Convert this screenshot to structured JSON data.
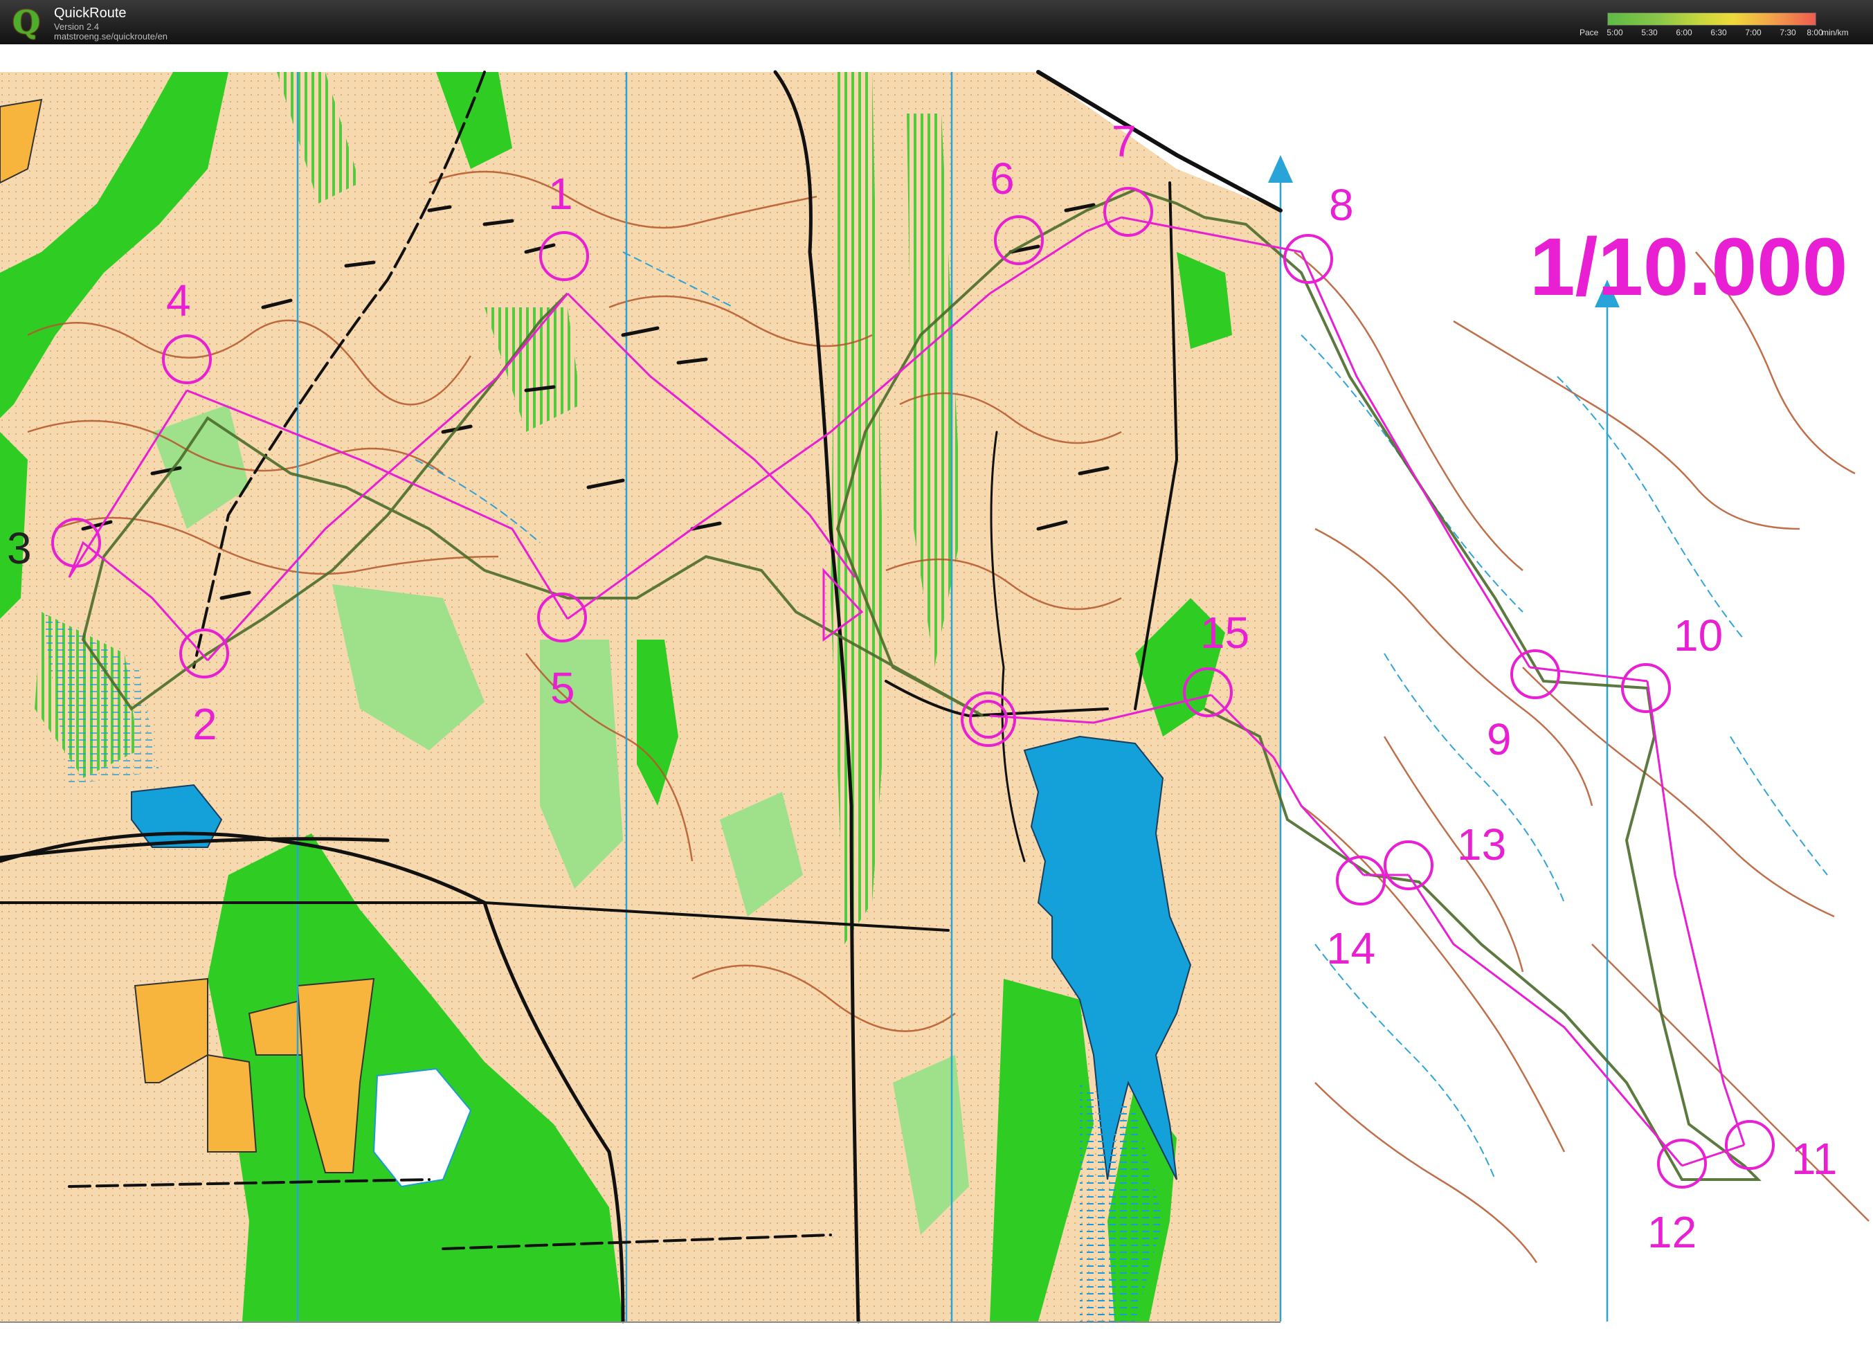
{
  "app": {
    "title": "QuickRoute",
    "version": "Version 2.4",
    "url": "matstroeng.se/quickroute/en",
    "logo_letter": "Q"
  },
  "pace_legend": {
    "label": "Pace",
    "ticks": [
      "5:00",
      "5:30",
      "6:00",
      "6:30",
      "7:00",
      "7:30",
      "8:00"
    ],
    "unit": "min/km",
    "colors": [
      "#5dbb44",
      "#c9d73d",
      "#eed93a",
      "#f3a64a",
      "#ee5b4f"
    ]
  },
  "map": {
    "scale_text": "1/10.000",
    "course_color": "#e81fd2",
    "route_color": "#4a6b2a",
    "control_labels": [
      "1",
      "2",
      "3",
      "4",
      "5",
      "6",
      "7",
      "8",
      "9",
      "10",
      "11",
      "12",
      "13",
      "14",
      "15"
    ],
    "colors": {
      "open_land": "#f7d9b0",
      "forest_green": "#2fcc24",
      "light_green": "#9fe08a",
      "water": "#14a0d8",
      "field_yellow": "#f7b53d",
      "contour": "#b5562a",
      "magnetic_north": "#29a4d9"
    }
  }
}
